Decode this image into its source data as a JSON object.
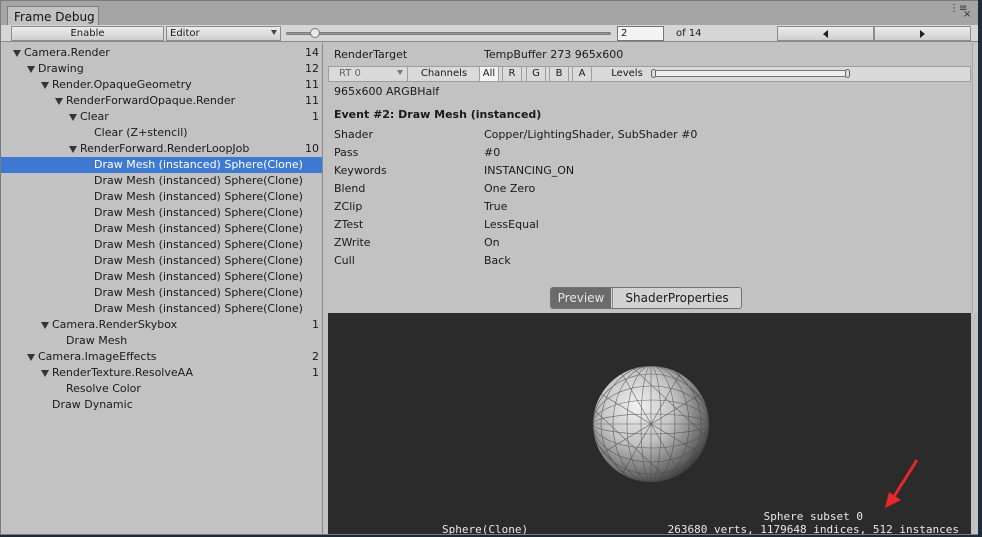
{
  "window": {
    "tab_title": "Frame Debug",
    "menu_glyph": "⋮≡",
    "close_glyph": "×"
  },
  "toolbar": {
    "enable_label": "Enable",
    "target_value": "Editor",
    "frame_slider_fraction": 0.07,
    "current_frame": "2",
    "total_label": "of 14"
  },
  "tree": [
    {
      "label": "Camera.Render",
      "count": "14",
      "depth": 0,
      "expanded": true,
      "selected": false
    },
    {
      "label": "Drawing",
      "count": "12",
      "depth": 1,
      "expanded": true,
      "selected": false
    },
    {
      "label": "Render.OpaqueGeometry",
      "count": "11",
      "depth": 2,
      "expanded": true,
      "selected": false
    },
    {
      "label": "RenderForwardOpaque.Render",
      "count": "11",
      "depth": 3,
      "expanded": true,
      "selected": false
    },
    {
      "label": "Clear",
      "count": "1",
      "depth": 4,
      "expanded": true,
      "selected": false
    },
    {
      "label": "Clear (Z+stencil)",
      "count": "",
      "depth": 5,
      "expanded": false,
      "selected": false
    },
    {
      "label": "RenderForward.RenderLoopJob",
      "count": "10",
      "depth": 4,
      "expanded": true,
      "selected": false
    },
    {
      "label": "Draw Mesh (instanced) Sphere(Clone)",
      "count": "",
      "depth": 5,
      "expanded": false,
      "selected": true
    },
    {
      "label": "Draw Mesh (instanced) Sphere(Clone)",
      "count": "",
      "depth": 5,
      "expanded": false,
      "selected": false
    },
    {
      "label": "Draw Mesh (instanced) Sphere(Clone)",
      "count": "",
      "depth": 5,
      "expanded": false,
      "selected": false
    },
    {
      "label": "Draw Mesh (instanced) Sphere(Clone)",
      "count": "",
      "depth": 5,
      "expanded": false,
      "selected": false
    },
    {
      "label": "Draw Mesh (instanced) Sphere(Clone)",
      "count": "",
      "depth": 5,
      "expanded": false,
      "selected": false
    },
    {
      "label": "Draw Mesh (instanced) Sphere(Clone)",
      "count": "",
      "depth": 5,
      "expanded": false,
      "selected": false
    },
    {
      "label": "Draw Mesh (instanced) Sphere(Clone)",
      "count": "",
      "depth": 5,
      "expanded": false,
      "selected": false
    },
    {
      "label": "Draw Mesh (instanced) Sphere(Clone)",
      "count": "",
      "depth": 5,
      "expanded": false,
      "selected": false
    },
    {
      "label": "Draw Mesh (instanced) Sphere(Clone)",
      "count": "",
      "depth": 5,
      "expanded": false,
      "selected": false
    },
    {
      "label": "Draw Mesh (instanced) Sphere(Clone)",
      "count": "",
      "depth": 5,
      "expanded": false,
      "selected": false
    },
    {
      "label": "Camera.RenderSkybox",
      "count": "1",
      "depth": 2,
      "expanded": true,
      "selected": false
    },
    {
      "label": "Draw Mesh",
      "count": "",
      "depth": 3,
      "expanded": false,
      "selected": false
    },
    {
      "label": "Camera.ImageEffects",
      "count": "2",
      "depth": 1,
      "expanded": true,
      "selected": false
    },
    {
      "label": "RenderTexture.ResolveAA",
      "count": "1",
      "depth": 2,
      "expanded": true,
      "selected": false
    },
    {
      "label": "Resolve Color",
      "count": "",
      "depth": 3,
      "expanded": false,
      "selected": false
    },
    {
      "label": "Draw Dynamic",
      "count": "",
      "depth": 2,
      "expanded": false,
      "selected": false
    }
  ],
  "details": {
    "render_target_label": "RenderTarget",
    "render_target_value": "TempBuffer 273 965x600",
    "rt_dropdown": "RT 0",
    "channels_label": "Channels",
    "channels": [
      "All",
      "R",
      "G",
      "B",
      "A"
    ],
    "active_channel": "All",
    "levels_label": "Levels",
    "format": "965x600 ARGBHalf",
    "event_title": "Event #2: Draw Mesh (instanced)",
    "properties": [
      {
        "key": "Shader",
        "value": "Copper/LightingShader, SubShader #0"
      },
      {
        "key": "Pass",
        "value": "#0"
      },
      {
        "key": "Keywords",
        "value": "INSTANCING_ON"
      },
      {
        "key": "Blend",
        "value": "One Zero"
      },
      {
        "key": "ZClip",
        "value": "True"
      },
      {
        "key": "ZTest",
        "value": "LessEqual"
      },
      {
        "key": "ZWrite",
        "value": "On"
      },
      {
        "key": "Cull",
        "value": "Back"
      }
    ]
  },
  "preview_tabs": {
    "preview_label": "Preview",
    "shader_props_label": "ShaderProperties",
    "active": "Preview"
  },
  "preview": {
    "subset_label": "Sphere subset 0",
    "object_name": "Sphere(Clone)",
    "stats": "263680 verts, 1179648 indices, 512 instances",
    "annotation_color": "#e8262b"
  },
  "colors": {
    "selection": "#3e7ad3",
    "panel_bg": "#c2c2c2",
    "preview_bg": "#2b2b2b"
  }
}
